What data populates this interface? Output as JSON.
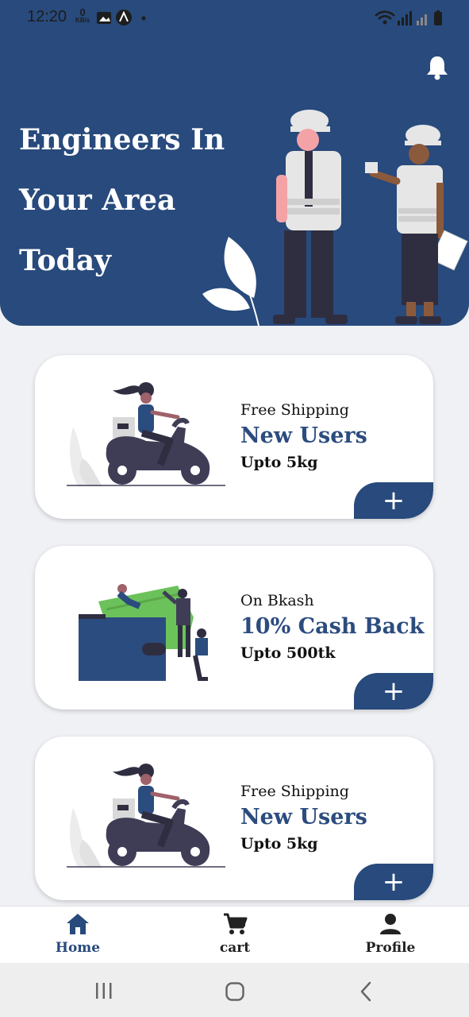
{
  "status_bar": {
    "time": "12:20",
    "kb_value": "0",
    "kb_unit": "KB/s"
  },
  "hero": {
    "title_lines": [
      "Engineers In",
      "Your Area",
      "Today"
    ],
    "bg_color": "#284a7c"
  },
  "cards": [
    {
      "top": "Free Shipping",
      "main": "New Users",
      "bottom": "Upto 5kg",
      "add_label": "+"
    },
    {
      "top": "On Bkash",
      "main": "10% Cash Back",
      "bottom": "Upto 500tk",
      "add_label": "+"
    },
    {
      "top": "Free Shipping",
      "main": "New Users",
      "bottom": "Upto 5kg",
      "add_label": "+"
    }
  ],
  "bottom_nav": {
    "items": [
      {
        "label": "Home",
        "icon": "home-icon",
        "active": true
      },
      {
        "label": "cart",
        "icon": "cart-icon",
        "active": false
      },
      {
        "label": "Profile",
        "icon": "person-icon",
        "active": false
      }
    ]
  },
  "colors": {
    "primary": "#284a7c",
    "accent_text": "#2b4c7e",
    "background": "#eff1f4"
  }
}
